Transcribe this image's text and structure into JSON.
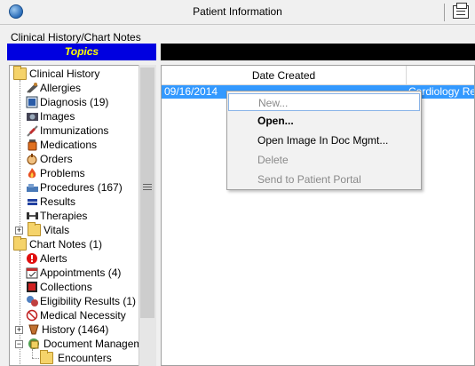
{
  "window": {
    "title": "Patient Information",
    "icon": "globe-icon",
    "action_icon": "printer-icon"
  },
  "subheader": "Clinical History/Chart Notes",
  "topics": {
    "label": "Topics",
    "bg": "#0000e0",
    "fg": "#ffff00"
  },
  "tree": {
    "clinical_history": {
      "label": "Clinical History",
      "items": [
        {
          "label": "Allergies",
          "icon": "allergies-icon"
        },
        {
          "label": "Diagnosis (19)",
          "icon": "diagnosis-icon"
        },
        {
          "label": "Images",
          "icon": "camera-icon"
        },
        {
          "label": "Immunizations",
          "icon": "syringe-icon"
        },
        {
          "label": "Medications",
          "icon": "pill-bottle-icon"
        },
        {
          "label": "Orders",
          "icon": "orders-icon"
        },
        {
          "label": "Problems",
          "icon": "fire-icon"
        },
        {
          "label": "Procedures (167)",
          "icon": "procedures-icon"
        },
        {
          "label": "Results",
          "icon": "results-icon"
        },
        {
          "label": "Therapies",
          "icon": "dumbbell-icon"
        },
        {
          "label": "Vitals",
          "icon": "folder-icon"
        }
      ]
    },
    "chart_notes": {
      "label": "Chart Notes (1)",
      "items": [
        {
          "label": "Alerts",
          "icon": "alert-icon"
        },
        {
          "label": "Appointments (4)",
          "icon": "appointments-icon"
        },
        {
          "label": "Collections",
          "icon": "collections-icon"
        },
        {
          "label": "Eligibility Results (1)",
          "icon": "eligibility-icon"
        },
        {
          "label": "Medical Necessity",
          "icon": "no-sign-icon"
        },
        {
          "label": "History (1464)",
          "icon": "history-icon"
        },
        {
          "label": "Document Manageme",
          "icon": "document-management-icon"
        },
        {
          "label": "Encounters",
          "icon": "folder-icon"
        }
      ]
    }
  },
  "grid": {
    "columns": [
      "Date Created"
    ],
    "rows": [
      {
        "date": "09/16/2014",
        "desc": "Cardiology Rep"
      }
    ]
  },
  "context_menu": {
    "items": [
      {
        "label": "New...",
        "state": "disabled"
      },
      {
        "label": "Open...",
        "state": "default"
      },
      {
        "label": "Open Image In Doc Mgmt...",
        "state": "enabled"
      },
      {
        "label": "Delete",
        "state": "disabled"
      },
      {
        "label": "Send to Patient Portal",
        "state": "disabled"
      }
    ]
  },
  "colors": {
    "selection": "#3399ff",
    "menu_highlight_border": "#8ab4e8"
  }
}
